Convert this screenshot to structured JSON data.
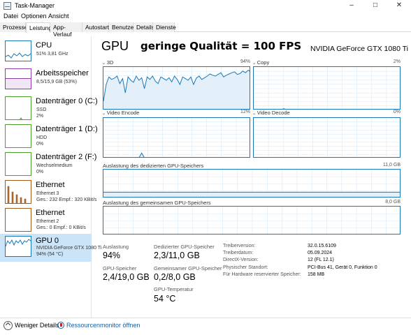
{
  "window": {
    "title": "Task-Manager",
    "controls": {
      "minimize": "–",
      "maximize": "□",
      "close": "✕"
    }
  },
  "menu": [
    "Datei",
    "Optionen",
    "Ansicht"
  ],
  "tabs": [
    "Prozesse",
    "Leistung",
    "App-Verlauf",
    "Autostart",
    "Benutzer",
    "Details",
    "Dienste"
  ],
  "active_tab": "Leistung",
  "sidebar": {
    "items": [
      {
        "title": "CPU",
        "line1": "51% 3,81 GHz",
        "line2": "",
        "color": "#1a78b8"
      },
      {
        "title": "Arbeitsspeicher",
        "line1": "8,5/15,9 GB (53%)",
        "line2": "",
        "color": "#8b3fa6"
      },
      {
        "title": "Datenträger 0 (C:)",
        "line1": "SSD",
        "line2": "2%",
        "color": "#4ca02c"
      },
      {
        "title": "Datenträger 1 (D:)",
        "line1": "HDD",
        "line2": "0%",
        "color": "#4ca02c"
      },
      {
        "title": "Datenträger 2 (F:)",
        "line1": "Wechselmedium",
        "line2": "0%",
        "color": "#4ca02c"
      },
      {
        "title": "Ethernet",
        "line1": "Ethernet 3",
        "line2": "Ges.: 232 Empf.: 320 KBit/s",
        "color": "#a65a1a"
      },
      {
        "title": "Ethernet",
        "line1": "Ethernet 2",
        "line2": "Ges.: 0 Empf.: 0 KBit/s",
        "color": "#a65a1a"
      },
      {
        "title": "GPU 0",
        "line1": "NVIDIA GeForce GTX 1080 Ti",
        "line2": "94% (54 °C)",
        "color": "#1a78b8"
      }
    ]
  },
  "main": {
    "heading": "GPU",
    "annotation": "geringe Qualität = 100 FPS",
    "model": "NVIDIA GeForce GTX 1080 Ti",
    "engines": [
      {
        "label": "3D",
        "max": "94%",
        "series": [
          20,
          60,
          78,
          72,
          75,
          80,
          62,
          74,
          40,
          78,
          70,
          65,
          80,
          70,
          76,
          50,
          78,
          72,
          80,
          68,
          62,
          78,
          74,
          70,
          76,
          66,
          80,
          72,
          60,
          78,
          74,
          70,
          78,
          60,
          75,
          80,
          72,
          76,
          80,
          85,
          82,
          80,
          84,
          88,
          78,
          82,
          85,
          88,
          90,
          84,
          86,
          92,
          88,
          94,
          90
        ]
      },
      {
        "label": "Copy",
        "max": "2%",
        "series": [
          0,
          0,
          0,
          0,
          0,
          0,
          0,
          0,
          0,
          0,
          0,
          2,
          0,
          1,
          0,
          0,
          0,
          0,
          1,
          0,
          0,
          0,
          0,
          0,
          1,
          0,
          0,
          0,
          0,
          0,
          0,
          0,
          0,
          0,
          0,
          0,
          0,
          0,
          0,
          0,
          0,
          0,
          0,
          0,
          0,
          0,
          0,
          0,
          0,
          0,
          0,
          0,
          0,
          0,
          0
        ]
      },
      {
        "label": "Video Encode",
        "max": "12%",
        "series": [
          0,
          0,
          0,
          0,
          0,
          0,
          0,
          0,
          0,
          0,
          0,
          0,
          0,
          0,
          12,
          0,
          0,
          0,
          0,
          0,
          0,
          0,
          0,
          0,
          0,
          0,
          0,
          0,
          0,
          0,
          0,
          0,
          0,
          0,
          0,
          0,
          0,
          0,
          0,
          0,
          0,
          0,
          0,
          0,
          0,
          0,
          0,
          0,
          0,
          0,
          0,
          0,
          0,
          0,
          0
        ]
      },
      {
        "label": "Video Decode",
        "max": "0%",
        "series": [
          0,
          0,
          0,
          0,
          0,
          0,
          0,
          0,
          0,
          0,
          0,
          0,
          0,
          0,
          0,
          0,
          0,
          0,
          0,
          0,
          0,
          0,
          0,
          0,
          0,
          0,
          0,
          0,
          0,
          0,
          0,
          0,
          0,
          0,
          0,
          0,
          0,
          0,
          0,
          0,
          0,
          0,
          0,
          0,
          0,
          0,
          0,
          0,
          0,
          0,
          0,
          0,
          0,
          0,
          0
        ]
      }
    ],
    "dedicated_mem": {
      "label": "Auslastung des dedizierten GPU-Speichers",
      "max": "11,0 GB",
      "fill_fraction": 0.21
    },
    "shared_mem": {
      "label": "Auslastung des gemeinsamen GPU-Speichers",
      "max": "8,0 GB",
      "fill_fraction": 0.025
    },
    "stats": {
      "auslastung": {
        "label": "Auslastung",
        "value": "94%"
      },
      "gpu_speicher": {
        "label": "GPU-Speicher",
        "value": "2,4/19,0 GB"
      },
      "dediziert": {
        "label": "Dedizierter GPU-Speicher",
        "value": "2,3/11,0 GB"
      },
      "gemeinsam": {
        "label": "Gemeinsamer GPU-Speicher",
        "value": "0,2/8,0 GB"
      },
      "temperatur": {
        "label": "GPU-Temperatur",
        "value": "54 °C"
      }
    },
    "info": [
      {
        "label": "Treiberversion:",
        "value": "32.0.15.6109"
      },
      {
        "label": "Treiberdatum:",
        "value": "05.09.2024"
      },
      {
        "label": "DirectX-Version:",
        "value": "12 (FL 12.1)"
      },
      {
        "label": "Physischer Standort:",
        "value": "PCI-Bus 41, Gerät 0, Funktion 0"
      },
      {
        "label": "Für Hardware reservierter Speicher:",
        "value": "158 MB"
      }
    ]
  },
  "footer": {
    "less_details": "Weniger Details",
    "resource_monitor": "Ressourcenmonitor öffnen"
  },
  "colors": {
    "accent": "#1a78b8",
    "graph_fill": "#e3f0fa",
    "selected": "#cce4f7"
  }
}
